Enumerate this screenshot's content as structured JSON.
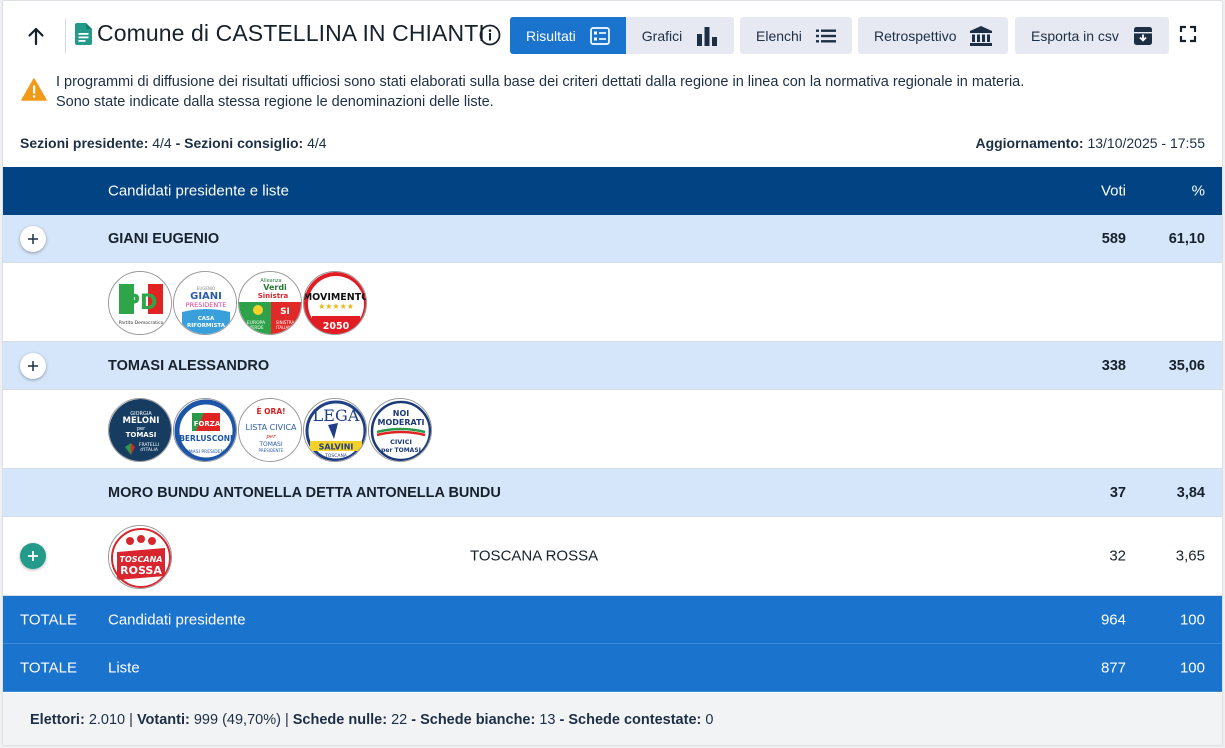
{
  "header": {
    "title": "Comune di CASTELLINA IN CHIANTI",
    "tabs": [
      {
        "label": "Risultati",
        "icon": "list-detail-icon",
        "active": true
      },
      {
        "label": "Grafici",
        "icon": "bar-chart-icon",
        "active": false
      }
    ],
    "elenchi_label": "Elenchi",
    "retrospettivo_label": "Retrospettivo",
    "esporta_label": "Esporta in csv"
  },
  "alert": {
    "line1": "I programmi di diffusione dei risultati ufficiosi sono stati elaborati sulla base dei criteri dettati dalla regione in linea con la normativa regionale in materia.",
    "line2": "Sono state indicate dalla stessa regione le denominazioni delle liste."
  },
  "meta": {
    "sezioni_presidente_label": "Sezioni presidente:",
    "sezioni_presidente_value": "4/4",
    "sezioni_consiglio_label": "Sezioni consiglio:",
    "sezioni_consiglio_value": "4/4",
    "aggiornamento_label": "Aggiornamento:",
    "aggiornamento_value": "13/10/2025 - 17:55"
  },
  "table": {
    "head": {
      "name": "Candidati presidente e liste",
      "voti": "Voti",
      "pct": "%"
    },
    "candidates": [
      {
        "name": "GIANI EUGENIO",
        "voti": "589",
        "pct": "61,10",
        "logos": [
          {
            "label_top": "PD",
            "label_bottom": "Partito Democratico"
          },
          {
            "label_top": "GIANI PRESIDENTE",
            "label_bottom": "CASA RIFORMISTA"
          },
          {
            "label_top": "Alleanza Verdi Sinistra",
            "label_bottom": "EUROPA VERDE · SINISTRA ITALIANA"
          },
          {
            "label_top": "MOVIMENTO",
            "label_bottom": "2050"
          }
        ]
      },
      {
        "name": "TOMASI ALESSANDRO",
        "voti": "338",
        "pct": "35,06",
        "logos": [
          {
            "label_top": "GIORGIA MELONI per TOMASI",
            "label_bottom": "FRATELLI d'ITALIA"
          },
          {
            "label_top": "FORZA ITALIA",
            "label_bottom": "BERLUSCONI"
          },
          {
            "label_top": "È ORA! LISTA CIVICA per",
            "label_bottom": "TOMASI PRESIDENTE"
          },
          {
            "label_top": "LEGA",
            "label_bottom": "SALVINI TOSCANA"
          },
          {
            "label_top": "NOI MODERATI",
            "label_bottom": "CIVICI per TOMASI"
          }
        ]
      },
      {
        "name": "MORO BUNDU ANTONELLA DETTA ANTONELLA BUNDU",
        "voti": "37",
        "pct": "3,84",
        "lists": [
          {
            "name": "TOSCANA ROSSA",
            "voti": "32",
            "pct": "3,65",
            "logo_label": "TOSCANA ROSSA"
          }
        ]
      }
    ],
    "totals": [
      {
        "label": "TOTALE",
        "name": "Candidati presidente",
        "voti": "964",
        "pct": "100"
      },
      {
        "label": "TOTALE",
        "name": "Liste",
        "voti": "877",
        "pct": "100"
      }
    ]
  },
  "footer": {
    "elettori_label": "Elettori:",
    "elettori_value": "2.010",
    "votanti_label": "Votanti:",
    "votanti_value": "999 (49,70%)",
    "nulle_label": "Schede nulle:",
    "nulle_value": "22",
    "bianche_label": "Schede bianche:",
    "bianche_value": "13",
    "contestate_label": "Schede contestate:",
    "contestate_value": "0"
  },
  "colors": {
    "header_row": "#024383",
    "candidate_row": "#d5e6fb",
    "total_row": "#1a73cc",
    "active_tab": "#1a73cc",
    "warning": "#f09a1a"
  }
}
